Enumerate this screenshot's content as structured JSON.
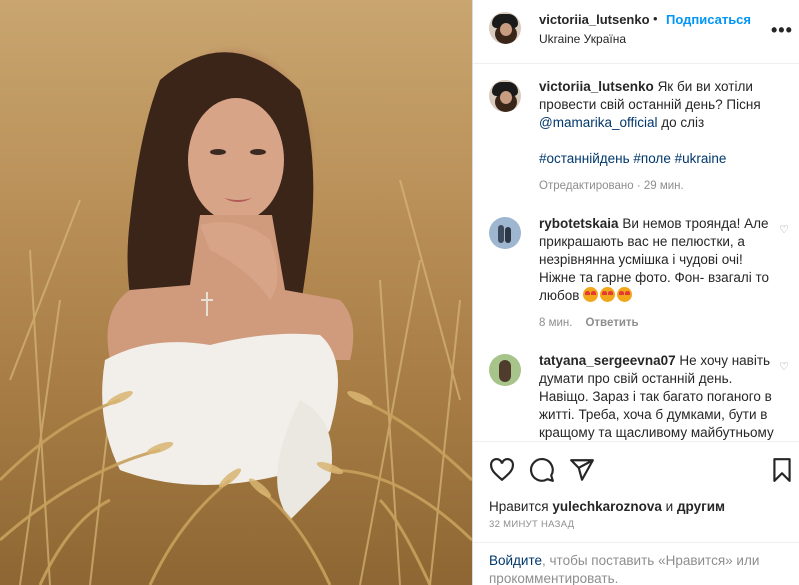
{
  "post": {
    "username": "victoriia_lutsenko",
    "dot": "•",
    "follow_label": "Подписаться",
    "location": "Ukraine Україна",
    "more_label": "•••"
  },
  "caption": {
    "username": "victoriia_lutsenko",
    "text_1": "Як би ви хотіли провести свій останній день? Пісня",
    "mention": "@mamarika_official",
    "text_2": "до сліз",
    "hashtags": [
      "#останнійдень",
      "#поле",
      "#ukraine"
    ],
    "meta": "Отредактировано · 29 мин."
  },
  "comments": [
    {
      "username": "rybotetskaia",
      "text": "Ви немов троянда! Але прикрашають вас не пелюстки, а незрівнянна усмішка і чудові очі! Ніжне та гарне фото. Фон- взагалі то любов",
      "emoji_count": 3,
      "time": "8 мин.",
      "reply_label": "Ответить"
    },
    {
      "username": "tatyana_sergeevna07",
      "text": "Не хочу навіть думати про свій останній день. Навіщо. Зараз і так багато поганого в житті. Треба, хоча б думками, бути в кращому та щасливому майбутньому"
    }
  ],
  "actions": {
    "likes_prefix": "Нравится",
    "likes_user": "yulechkaroznova",
    "likes_and": "и",
    "likes_others": "другим",
    "timestamp": "32 МИНУТ НАЗАД"
  },
  "login_prompt": {
    "link": "Войдите",
    "text": ", чтобы поставить «Нравится» или прокомментировать."
  },
  "icons": [
    "heart-icon",
    "comment-icon",
    "share-icon",
    "bookmark-icon",
    "more-icon"
  ],
  "colors": {
    "link_blue": "#0095f6",
    "mention": "#00376b",
    "meta_gray": "#8e8e8e"
  }
}
